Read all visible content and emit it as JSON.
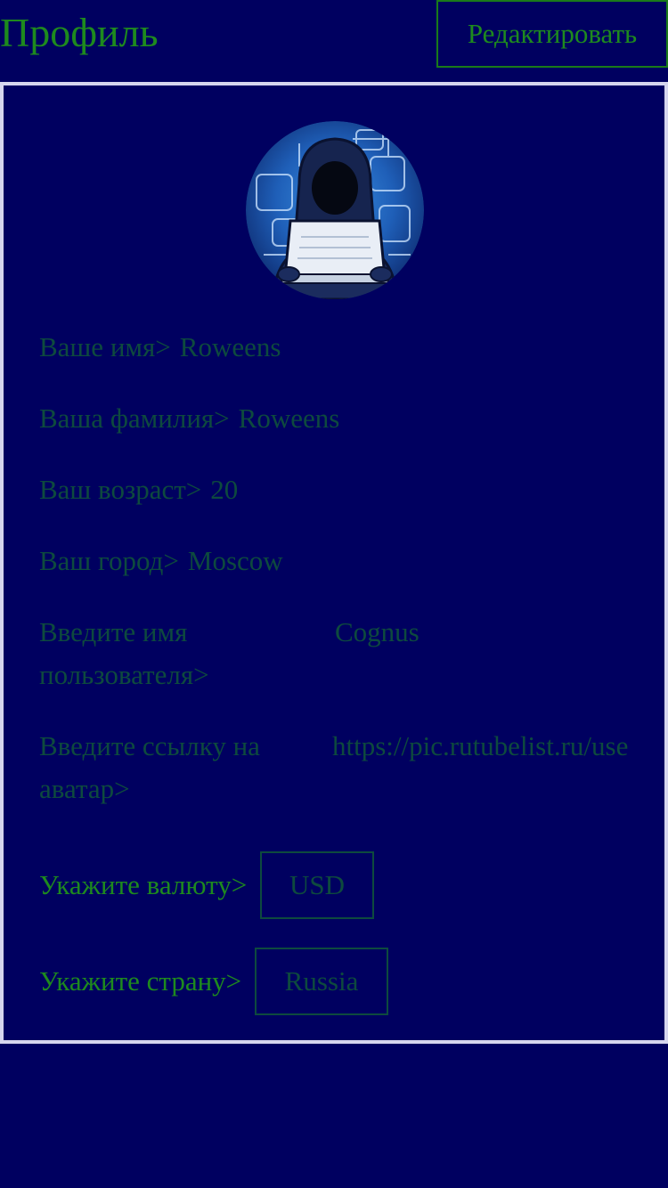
{
  "header": {
    "title": "Профиль",
    "edit_label": "Редактировать"
  },
  "profile": {
    "first_name_label": "Ваше имя>",
    "first_name": "Roweens",
    "last_name_label": "Ваша фамилия>",
    "last_name": "Roweens",
    "age_label": "Ваш возраст>",
    "age": "20",
    "city_label": "Ваш город>",
    "city": "Moscow",
    "username_label": "Введите имя пользователя>",
    "username": "Cognus",
    "avatar_url_label": "Введите ссылку на аватар>",
    "avatar_url": "https://pic.rutubelist.ru/use",
    "currency_label": "Укажите валюту>",
    "currency": "USD",
    "country_label": "Укажите страну>",
    "country": "Russia"
  },
  "colors": {
    "background": "#000060",
    "accent_green": "#1e8a1e",
    "muted_green": "#0e4a3e",
    "card_border": "#d6d6ee"
  },
  "icons": {
    "avatar": "hooded-hacker-with-laptop-avatar"
  }
}
